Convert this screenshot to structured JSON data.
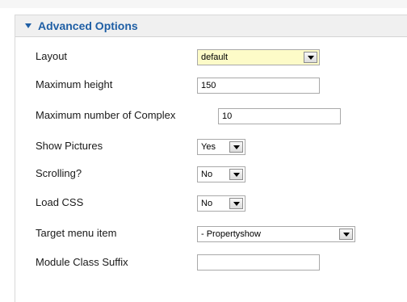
{
  "panel": {
    "title": "Advanced Options"
  },
  "fields": {
    "layout": {
      "label": "Layout",
      "value": "default"
    },
    "max_height": {
      "label": "Maximum height",
      "value": "150"
    },
    "max_complex": {
      "label": "Maximum number of Complex",
      "value": "10"
    },
    "show_pictures": {
      "label": "Show Pictures",
      "value": "Yes"
    },
    "scrolling": {
      "label": "Scrolling?",
      "value": "No"
    },
    "load_css": {
      "label": "Load CSS",
      "value": "No"
    },
    "target_menu": {
      "label": "Target menu item",
      "value": "- Propertyshow"
    },
    "class_suffix": {
      "label": "Module Class Suffix",
      "value": ""
    }
  },
  "colors": {
    "accent": "#1f5fa5",
    "highlight": "#fdfbc8"
  }
}
